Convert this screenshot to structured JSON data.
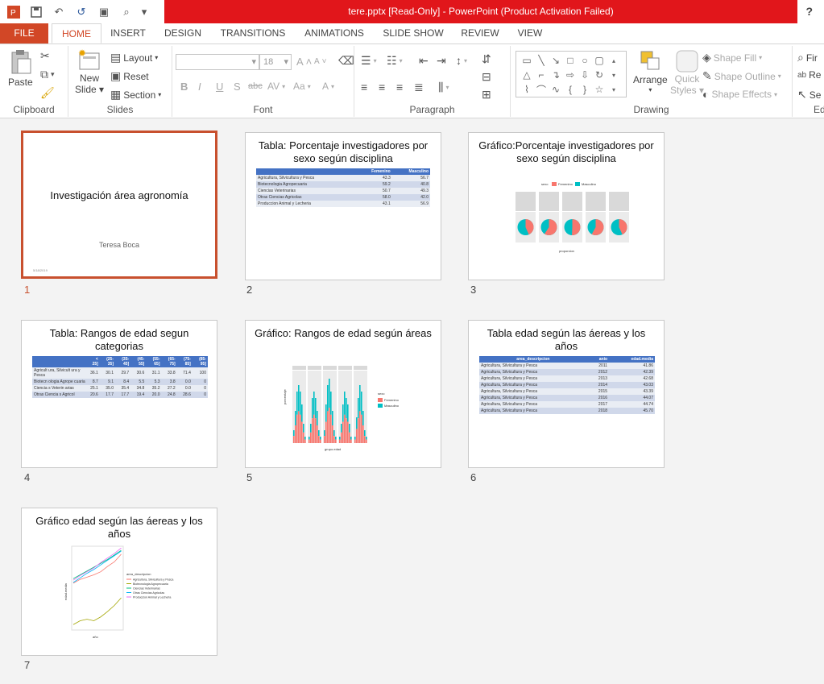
{
  "window": {
    "title": "tere.pptx [Read-Only] -  PowerPoint (Product Activation Failed)",
    "help": "?"
  },
  "tabs": [
    "FILE",
    "HOME",
    "INSERT",
    "DESIGN",
    "TRANSITIONS",
    "ANIMATIONS",
    "SLIDE SHOW",
    "REVIEW",
    "VIEW"
  ],
  "ribbon": {
    "clipboard": {
      "label": "Clipboard",
      "paste": "Paste"
    },
    "slides": {
      "label": "Slides",
      "new_slide_1": "New",
      "new_slide_2": "Slide",
      "layout": "Layout",
      "reset": "Reset",
      "section": "Section"
    },
    "font": {
      "label": "Font",
      "size": "18",
      "bold": "B",
      "italic": "I",
      "underline": "U",
      "shadow": "S",
      "strike": "abc",
      "spacing": "AV",
      "case": "Aa",
      "grow": "A",
      "shrink": "A"
    },
    "paragraph": {
      "label": "Paragraph"
    },
    "drawing": {
      "label": "Drawing",
      "arrange": "Arrange",
      "quick_styles_1": "Quick",
      "quick_styles_2": "Styles",
      "shape_fill": "Shape Fill",
      "shape_outline": "Shape Outline",
      "shape_effects": "Shape Effects"
    },
    "editing": {
      "find": "Fir",
      "replace": "Re",
      "select": "Se",
      "label": "Ed"
    }
  },
  "slides": [
    {
      "num": "1",
      "title": "Investigación área agronomía",
      "subtitle": "Teresa Boca",
      "date": "5/18/2019"
    },
    {
      "num": "2",
      "title": "Tabla: Porcentaje investigadores por sexo según disciplina",
      "table": {
        "headers": [
          "",
          "Femenino",
          "Masculino"
        ],
        "rows": [
          [
            "Agricultura, Silvicultura y Pesca",
            "43.3",
            "56.7"
          ],
          [
            "Biotecnologia Agropecuaria",
            "59.2",
            "40.8"
          ],
          [
            "Ciencias Veterinarias",
            "50.7",
            "49.3"
          ],
          [
            "Otras Ciencias Agricolas",
            "58.0",
            "42.0"
          ],
          [
            "Produccion Animal y Lecheria",
            "43.1",
            "56.9"
          ]
        ]
      }
    },
    {
      "num": "3",
      "title": "Gráfico:Porcentaje investigadores por sexo según disciplina",
      "legend_title": "sexo",
      "legend": [
        "Femenino",
        "Masculino"
      ],
      "xlabel": "proporcion"
    },
    {
      "num": "4",
      "title": "Tabla: Rangos de edad segun categorias",
      "table": {
        "headers": [
          "",
          "< 25]",
          "(25-35]",
          "(35-45]",
          "(45-55]",
          "(55-65]",
          "(65-75]",
          "(75-85]",
          "(85-95]"
        ],
        "rows": [
          [
            "Agricult ura, Silvicult ura y Pesca",
            "36.1",
            "30.1",
            "29.7",
            "30.6",
            "31.1",
            "33.8",
            "71.4",
            "100"
          ],
          [
            "Biotecn ologia Agrope cuaria",
            "8.7",
            "9.1",
            "8.4",
            "5.5",
            "5.3",
            "3.8",
            "0.0",
            "0"
          ],
          [
            "Ciencia s Veterin arias",
            "25.1",
            "35.0",
            "35.4",
            "34.8",
            "35.2",
            "27.2",
            "0.0",
            "0"
          ],
          [
            "Otras Ciencia s Agricol",
            "20.6",
            "17.7",
            "17.7",
            "19.4",
            "20.0",
            "24.8",
            "28.6",
            "0"
          ]
        ]
      }
    },
    {
      "num": "5",
      "title": "Gráfico: Rangos de edad según áreas",
      "legend_title": "sexo",
      "legend": [
        "Femenino",
        "Masculino"
      ],
      "xlabel": "grupo.edad",
      "ylabel": "porcentaje"
    },
    {
      "num": "6",
      "title": "Tabla edad según las áereas y los años",
      "table": {
        "headers": [
          "area_descripcion",
          "anio",
          "edad.media"
        ],
        "rows": [
          [
            "Agricultura, Silvicultura y Pesca",
            "2011",
            "41.86"
          ],
          [
            "Agricultura, Silvicultura y Pesca",
            "2012",
            "42.39"
          ],
          [
            "Agricultura, Silvicultura y Pesca",
            "2013",
            "42.68"
          ],
          [
            "Agricultura, Silvicultura y Pesca",
            "2014",
            "43.03"
          ],
          [
            "Agricultura, Silvicultura y Pesca",
            "2015",
            "43.39"
          ],
          [
            "Agricultura, Silvicultura y Pesca",
            "2016",
            "44.07"
          ],
          [
            "Agricultura, Silvicultura y Pesca",
            "2017",
            "44.74"
          ],
          [
            "Agricultura, Silvicultura y Pesca",
            "2018",
            "45.70"
          ]
        ]
      }
    },
    {
      "num": "7",
      "title": "Gráfico edad según las áereas y los años",
      "legend_title": "area_descripcion",
      "legend": [
        "Agricultura, Silvicultura y Pesca",
        "Biotecnologia Agropecuaria",
        "Ciencias Veterinarias",
        "Otras Ciencias Agricolas",
        "Produccion Animal y Lecheria"
      ],
      "xlabel": "año",
      "ylabel": "edad.media"
    }
  ]
}
